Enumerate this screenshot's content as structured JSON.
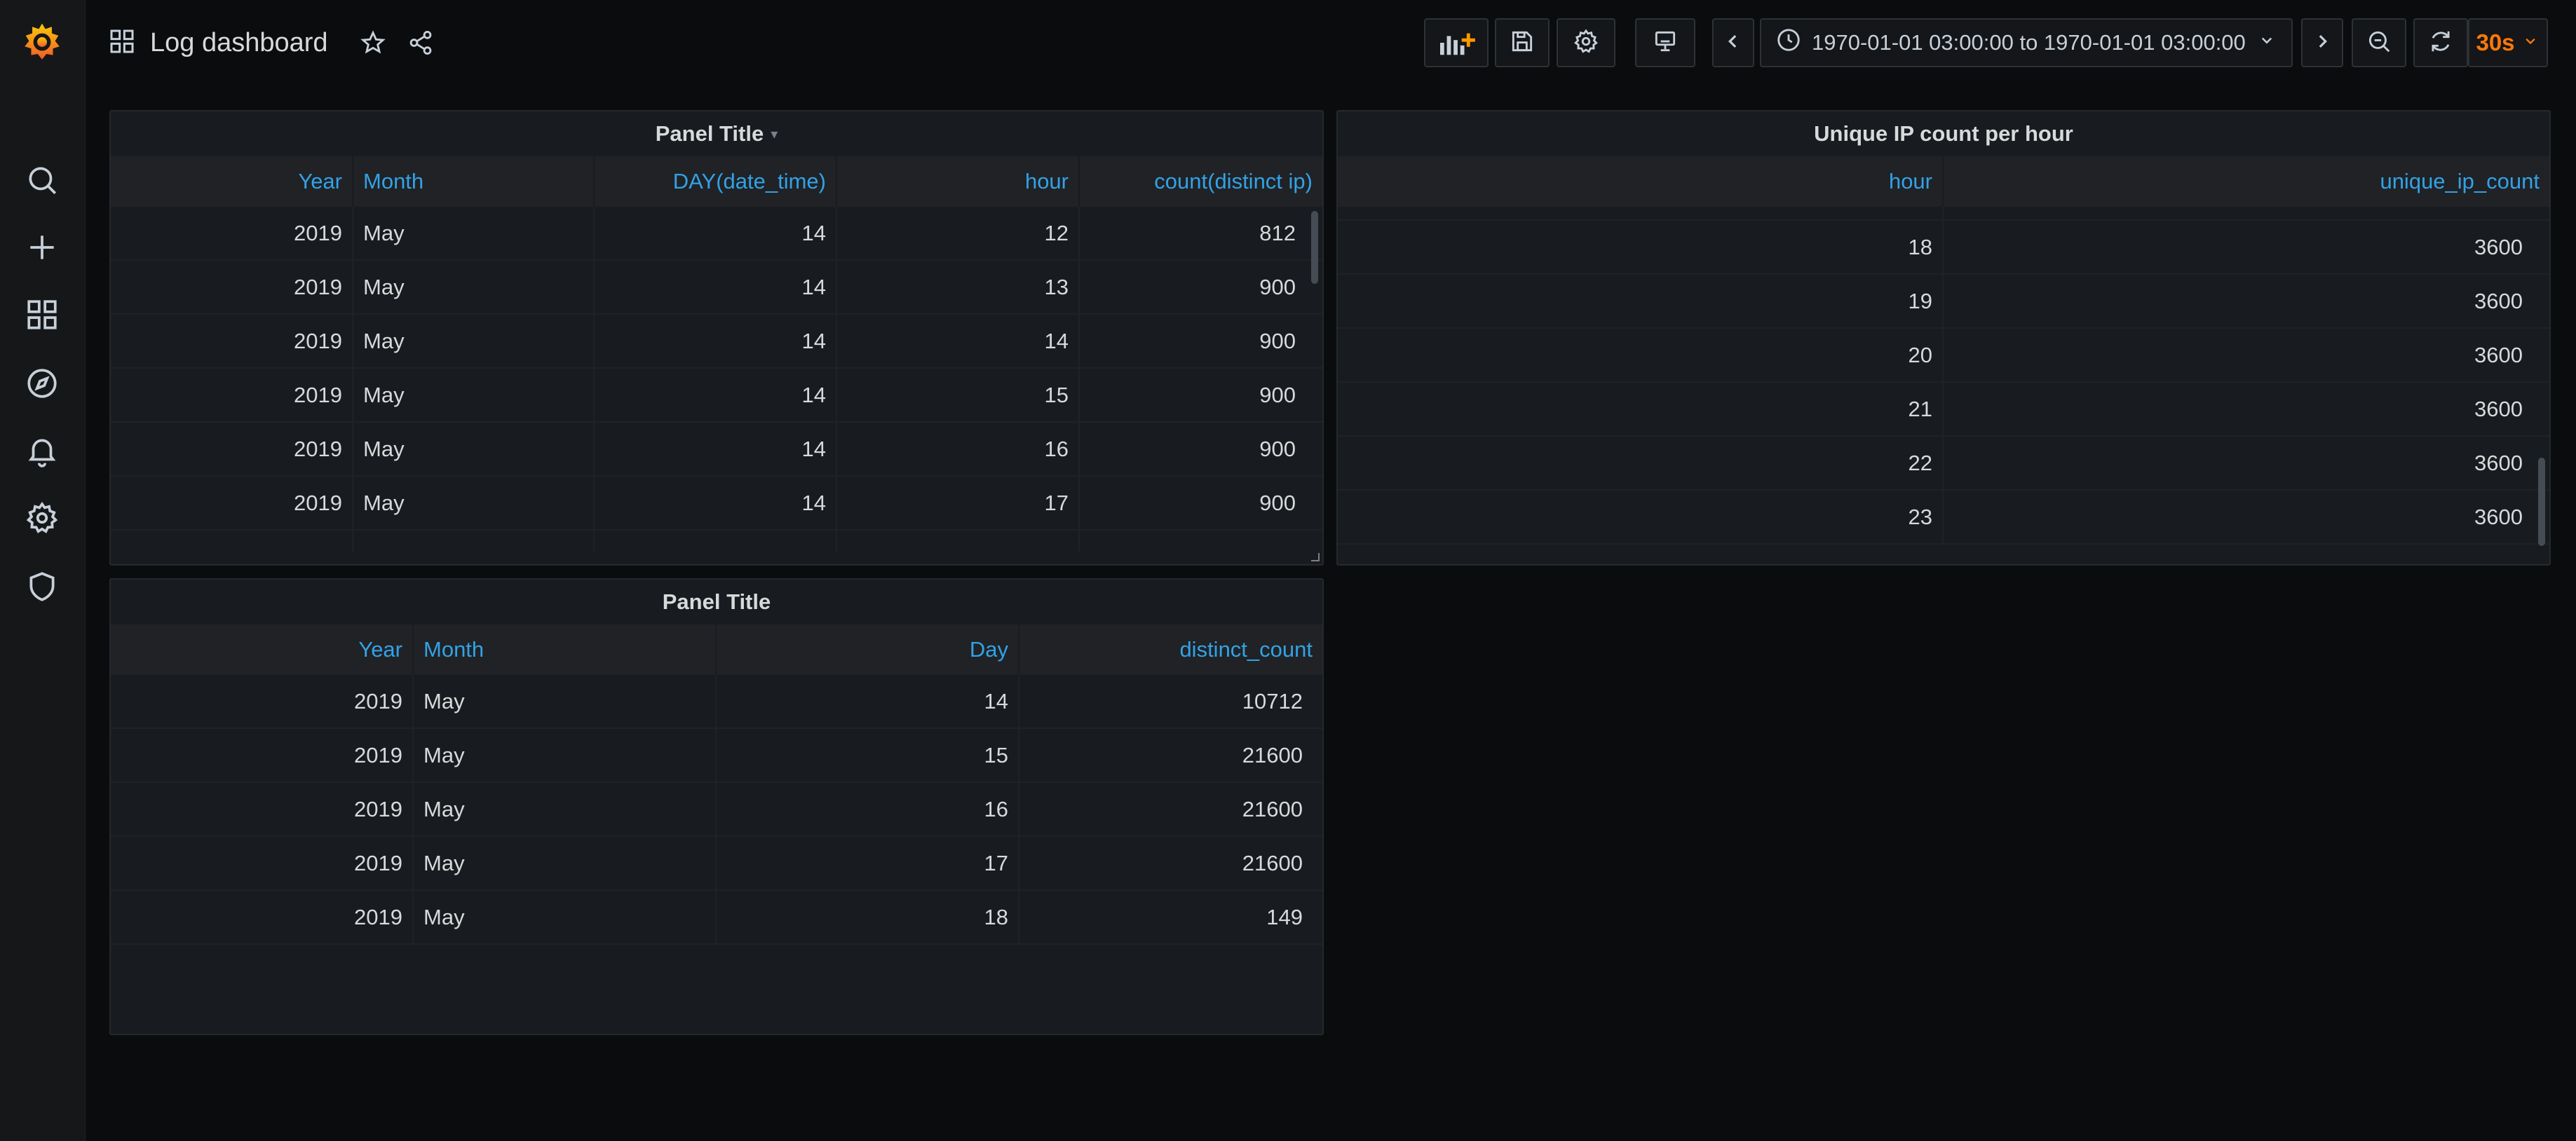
{
  "header": {
    "title": "Log dashboard",
    "time_range": "1970-01-01 03:00:00 to 1970-01-01 03:00:00",
    "refresh_interval": "30s"
  },
  "panels": {
    "hourly": {
      "title": "Panel Title",
      "columns": [
        "Year",
        "Month",
        "DAY(date_time)",
        "hour",
        "count(distinct ip)"
      ],
      "rows": [
        [
          "2019",
          "May",
          "14",
          "12",
          "812"
        ],
        [
          "2019",
          "May",
          "14",
          "13",
          "900"
        ],
        [
          "2019",
          "May",
          "14",
          "14",
          "900"
        ],
        [
          "2019",
          "May",
          "14",
          "15",
          "900"
        ],
        [
          "2019",
          "May",
          "14",
          "16",
          "900"
        ],
        [
          "2019",
          "May",
          "14",
          "17",
          "900"
        ]
      ]
    },
    "unique_ip": {
      "title": "Unique IP count per hour",
      "columns": [
        "hour",
        "unique_ip_count"
      ],
      "rows": [
        [
          "18",
          "3600"
        ],
        [
          "19",
          "3600"
        ],
        [
          "20",
          "3600"
        ],
        [
          "21",
          "3600"
        ],
        [
          "22",
          "3600"
        ],
        [
          "23",
          "3600"
        ]
      ]
    },
    "daily": {
      "title": "Panel Title",
      "columns": [
        "Year",
        "Month",
        "Day",
        "distinct_count"
      ],
      "rows": [
        [
          "2019",
          "May",
          "14",
          "10712"
        ],
        [
          "2019",
          "May",
          "15",
          "21600"
        ],
        [
          "2019",
          "May",
          "16",
          "21600"
        ],
        [
          "2019",
          "May",
          "17",
          "21600"
        ],
        [
          "2019",
          "May",
          "18",
          "149"
        ]
      ]
    }
  },
  "colors": {
    "background": "#0b0c0e",
    "panel": "#181b1f",
    "header_text": "#33a2e5",
    "refresh_accent": "#ff780a"
  }
}
